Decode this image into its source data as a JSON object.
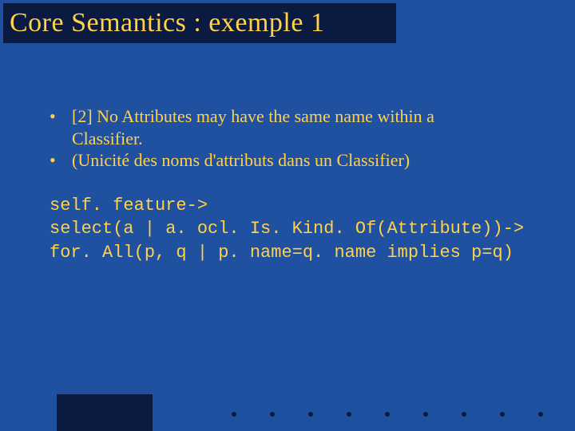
{
  "title": "Core Semantics : exemple 1",
  "bullets": [
    {
      "text_line1": "[2] No Attributes may have the same name within a",
      "text_line2": "Classifier."
    },
    {
      "text_line1": "(Unicité des noms d'attributs dans un Classifier)",
      "text_line2": ""
    }
  ],
  "code": {
    "line1": "self. feature->",
    "line2": "select(a | a. ocl. Is. Kind. Of(Attribute))->",
    "line3": "for. All(p, q | p. name=q. name implies p=q)"
  },
  "colors": {
    "background": "#2050a0",
    "box": "#0a1a40",
    "text": "#ffd24a"
  }
}
